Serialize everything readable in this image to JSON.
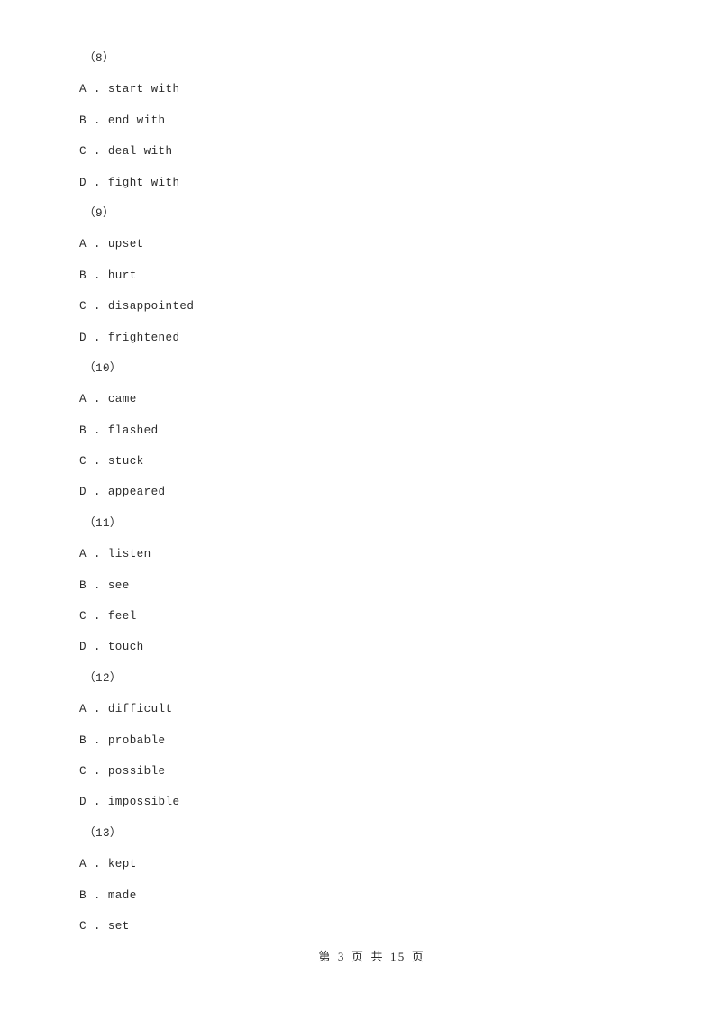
{
  "document": {
    "page_background": "#ffffff",
    "text_color": "#2b2b2b"
  },
  "questions": [
    {
      "number": "（8）",
      "options": [
        {
          "letter": "A",
          "separator": " . ",
          "text": "start with"
        },
        {
          "letter": "B",
          "separator": " . ",
          "text": "end with"
        },
        {
          "letter": "C",
          "separator": " . ",
          "text": "deal with"
        },
        {
          "letter": "D",
          "separator": " . ",
          "text": "fight with"
        }
      ]
    },
    {
      "number": "（9）",
      "options": [
        {
          "letter": "A",
          "separator": " . ",
          "text": "upset"
        },
        {
          "letter": "B",
          "separator": " . ",
          "text": "hurt"
        },
        {
          "letter": "C",
          "separator": " . ",
          "text": "disappointed"
        },
        {
          "letter": "D",
          "separator": " . ",
          "text": "frightened"
        }
      ]
    },
    {
      "number": "（10）",
      "options": [
        {
          "letter": "A",
          "separator": " . ",
          "text": "came"
        },
        {
          "letter": "B",
          "separator": " . ",
          "text": "flashed"
        },
        {
          "letter": "C",
          "separator": " . ",
          "text": "stuck"
        },
        {
          "letter": "D",
          "separator": " . ",
          "text": "appeared"
        }
      ]
    },
    {
      "number": "（11）",
      "options": [
        {
          "letter": "A",
          "separator": " . ",
          "text": "listen"
        },
        {
          "letter": "B",
          "separator": " . ",
          "text": "see"
        },
        {
          "letter": "C",
          "separator": " . ",
          "text": "feel"
        },
        {
          "letter": "D",
          "separator": " . ",
          "text": "touch"
        }
      ]
    },
    {
      "number": "（12）",
      "options": [
        {
          "letter": "A",
          "separator": " . ",
          "text": "difficult"
        },
        {
          "letter": "B",
          "separator": " . ",
          "text": "probable"
        },
        {
          "letter": "C",
          "separator": " . ",
          "text": "possible"
        },
        {
          "letter": "D",
          "separator": " . ",
          "text": "impossible"
        }
      ]
    },
    {
      "number": "（13）",
      "options": [
        {
          "letter": "A",
          "separator": " . ",
          "text": "kept"
        },
        {
          "letter": "B",
          "separator": " . ",
          "text": "made"
        },
        {
          "letter": "C",
          "separator": " . ",
          "text": "set"
        }
      ]
    }
  ],
  "footer": {
    "prefix": "第",
    "current_page": "3",
    "middle": "页 共",
    "total_pages": "15",
    "suffix": "页",
    "full_text": "第 3 页 共 15 页"
  }
}
